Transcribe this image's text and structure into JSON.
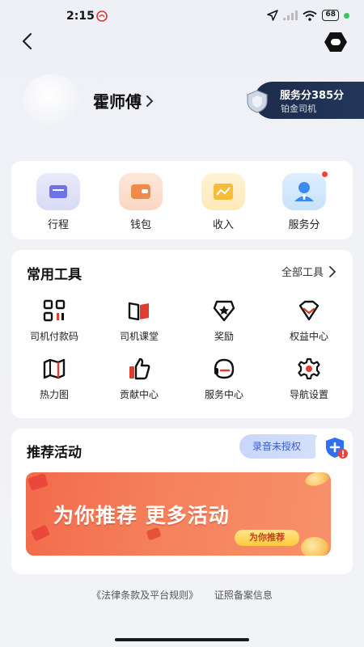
{
  "status_bar": {
    "time": "2:15",
    "battery": "68"
  },
  "profile": {
    "name": "霍师傅",
    "service_score": "服务分385分",
    "level": "铂金司机"
  },
  "quick_actions": [
    {
      "label": "行程",
      "icon": "trip-icon"
    },
    {
      "label": "钱包",
      "icon": "wallet-icon"
    },
    {
      "label": "收入",
      "icon": "income-icon"
    },
    {
      "label": "服务分",
      "icon": "service-score-icon"
    }
  ],
  "tools": {
    "title": "常用工具",
    "all_label": "全部工具",
    "items": [
      {
        "label": "司机付款码",
        "icon": "qr-code-icon"
      },
      {
        "label": "司机课堂",
        "icon": "book-icon"
      },
      {
        "label": "奖励",
        "icon": "reward-star-icon"
      },
      {
        "label": "权益中心",
        "icon": "benefits-icon"
      },
      {
        "label": "热力图",
        "icon": "heatmap-icon"
      },
      {
        "label": "贡献中心",
        "icon": "thumbs-up-icon"
      },
      {
        "label": "服务中心",
        "icon": "headset-icon"
      },
      {
        "label": "导航设置",
        "icon": "gear-icon"
      }
    ]
  },
  "activity": {
    "title": "推荐活动",
    "record_status": "录音未授权",
    "banner_title": "为你推荐  更多活动",
    "banner_button": "为你推荐"
  },
  "footer": {
    "legal": "《法律条款及平台规则》",
    "license": "证照备案信息"
  },
  "colors": {
    "accent_blue": "#3a5bd0",
    "badge_navy": "#1c2c4c",
    "banner_orange": "#f36a4b"
  }
}
